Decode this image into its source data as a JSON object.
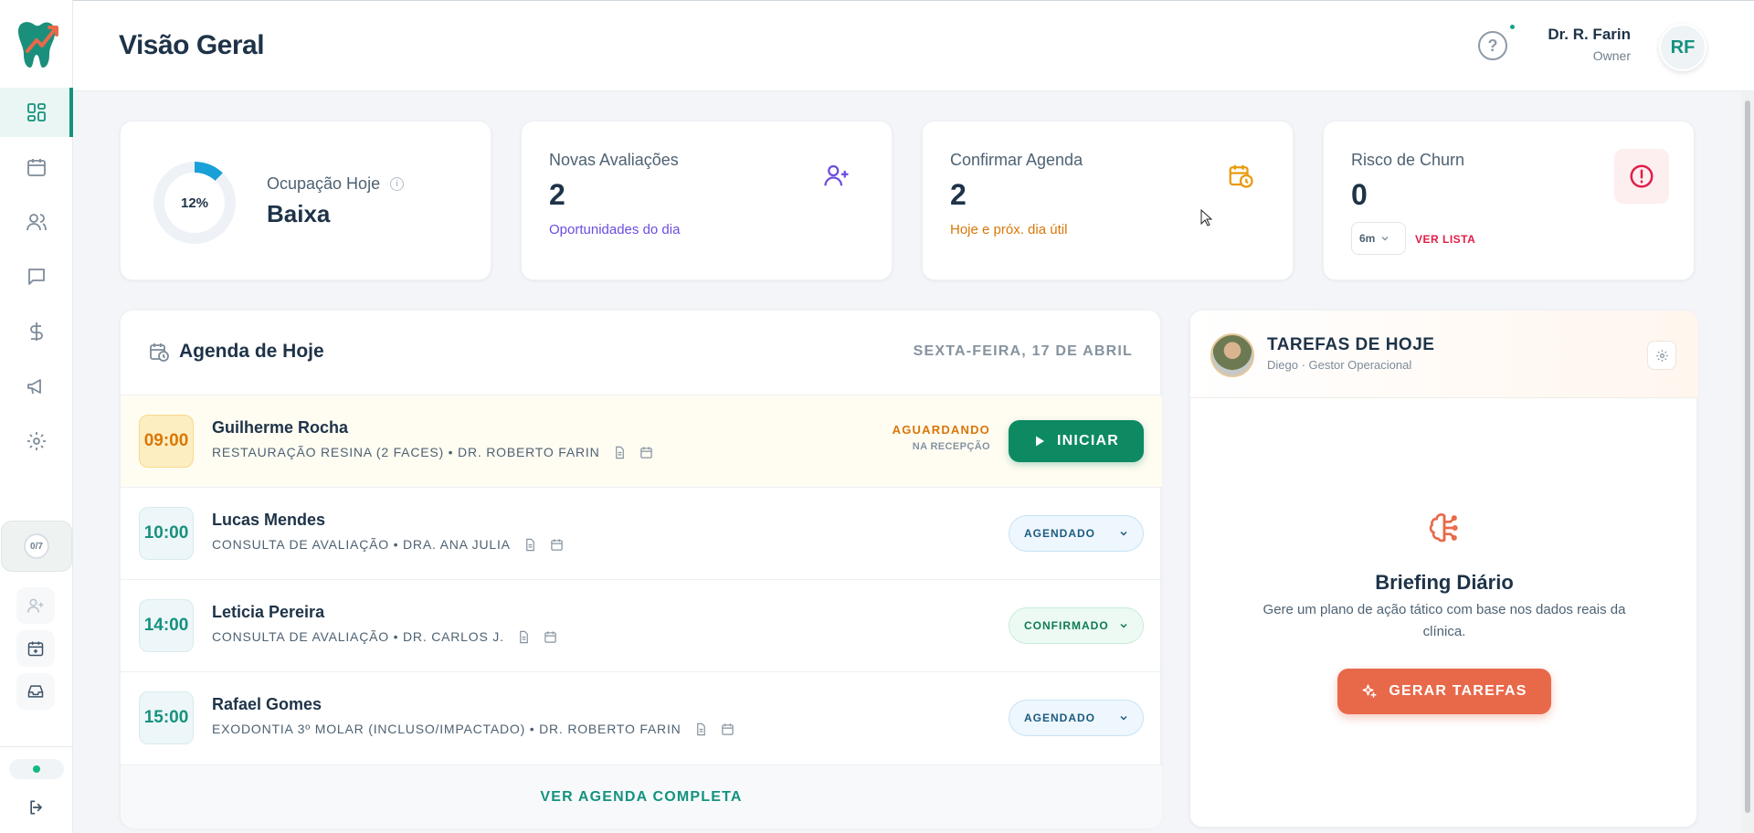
{
  "header": {
    "title": "Visão Geral",
    "user_name": "Dr. R. Farin",
    "user_role": "Owner",
    "avatar_initials": "RF",
    "help_symbol": "?"
  },
  "sidebar": {
    "items": [
      {
        "icon": "dashboard-icon",
        "active": true
      },
      {
        "icon": "calendar-icon",
        "active": false
      },
      {
        "icon": "users-icon",
        "active": false
      },
      {
        "icon": "chat-icon",
        "active": false
      },
      {
        "icon": "dollar-icon",
        "active": false
      },
      {
        "icon": "megaphone-icon",
        "active": false
      },
      {
        "icon": "settings-icon",
        "active": false
      }
    ],
    "progress": "0/7",
    "status_color": "#10b981"
  },
  "stats": {
    "occupancy": {
      "label": "Ocupação Hoje",
      "value": "Baixa",
      "percent_label": "12%",
      "percent": 12
    },
    "new_evaluations": {
      "label": "Novas Avaliações",
      "value": "2",
      "sub": "Oportunidades do dia"
    },
    "confirm_schedule": {
      "label": "Confirmar Agenda",
      "value": "2",
      "sub": "Hoje e próx. dia útil"
    },
    "churn": {
      "label": "Risco de Churn",
      "value": "0",
      "period": "6m",
      "link": "VER LISTA"
    }
  },
  "agenda": {
    "title": "Agenda de Hoje",
    "date": "SEXTA-FEIRA, 17 DE ABRIL",
    "appointments": [
      {
        "time": "09:00",
        "patient": "Guilherme Rocha",
        "procedure": "RESTAURAÇÃO RESINA (2 FACES) • DR. ROBERTO FARIN",
        "status": "AGUARDANDO",
        "status_sub": "NA RECEPÇÃO",
        "action": "INICIAR"
      },
      {
        "time": "10:00",
        "patient": "Lucas Mendes",
        "procedure": "CONSULTA DE AVALIAÇÃO • DRA. ANA JULIA",
        "status": "AGENDADO"
      },
      {
        "time": "14:00",
        "patient": "Leticia Pereira",
        "procedure": "CONSULTA DE AVALIAÇÃO • DR. CARLOS J.",
        "status": "CONFIRMADO"
      },
      {
        "time": "15:00",
        "patient": "Rafael Gomes",
        "procedure": "EXODONTIA 3º MOLAR (INCLUSO/IMPACTADO) • DR. ROBERTO FARIN",
        "status": "AGENDADO"
      }
    ],
    "footer_link": "VER AGENDA COMPLETA"
  },
  "tasks": {
    "title": "TAREFAS DE HOJE",
    "subtitle": "Diego · Gestor Operacional",
    "briefing_title": "Briefing Diário",
    "briefing_text": "Gere um plano de ação tático com base nos dados reais da clínica.",
    "button": "GERAR TAREFAS"
  },
  "colors": {
    "accent": "#15927e",
    "orange": "#d97706",
    "danger": "#e11d48",
    "coral": "#e8694a",
    "purple": "#6d4ce0"
  }
}
